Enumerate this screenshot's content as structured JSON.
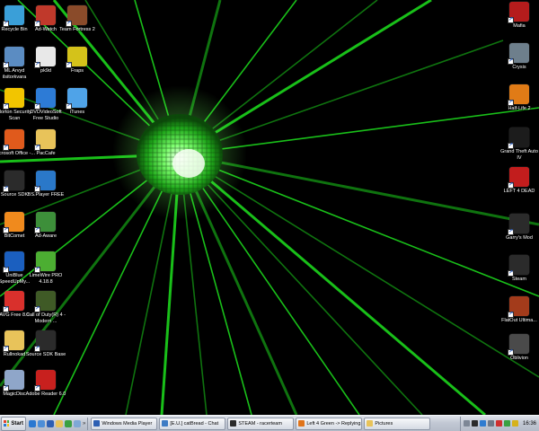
{
  "colors": {
    "laser": "#22ff22",
    "taskbar": "#c2c8d4",
    "desktop_bg": "#000000"
  },
  "desktop": {
    "left_icons": [
      {
        "label": "Recycle Bin",
        "icon": "recycle-bin-icon",
        "color": "#3a9fd8"
      },
      {
        "label": "Ad-Watch",
        "icon": "ad-watch-icon",
        "color": "#c0392b"
      },
      {
        "label": "Team Fortress 2",
        "icon": "team-fortress-icon",
        "color": "#8a4b2a"
      },
      {
        "label": "ML Arvyd ilsitorkvara",
        "icon": "shortcut-icon",
        "color": "#5b8cc2"
      },
      {
        "label": "pk9d",
        "icon": "file-icon",
        "color": "#e8e8e8"
      },
      {
        "label": "Fraps",
        "icon": "fraps-icon",
        "color": "#d4c21a"
      },
      {
        "label": "Norton Security Scan",
        "icon": "norton-icon",
        "color": "#f2c500"
      },
      {
        "label": "DVDVideoSoft Free Studio",
        "icon": "dvd-icon",
        "color": "#2d7bd6"
      },
      {
        "label": "iTunes",
        "icon": "itunes-icon",
        "color": "#4fa3e8"
      },
      {
        "label": "Microsoft Office -...",
        "icon": "office-icon",
        "color": "#e05a1c"
      },
      {
        "label": "PacCafe",
        "icon": "folder-icon",
        "color": "#e8c35a"
      },
      {
        "label": "Source SDK",
        "icon": "steam-icon",
        "color": "#2b2b2b"
      },
      {
        "label": "BS.Player FREE",
        "icon": "bsplayer-icon",
        "color": "#2a78c9"
      },
      {
        "label": "BitComet",
        "icon": "bitcomet-icon",
        "color": "#f08a1d"
      },
      {
        "label": "Ad-Aware",
        "icon": "ad-aware-icon",
        "color": "#3d8f3a"
      },
      {
        "label": "UniBlue SpeedUpMy...",
        "icon": "speedup-icon",
        "color": "#1b5fbf"
      },
      {
        "label": "LimeWire PRO 4.18.8",
        "icon": "limewire-icon",
        "color": "#4cae32"
      },
      {
        "label": "AVG Free 8.0",
        "icon": "avg-icon",
        "color": "#d9302c"
      },
      {
        "label": "Call of Duty(R) 4 - Modern ...",
        "icon": "call-of-duty-icon",
        "color": "#3f5a26"
      },
      {
        "label": "Rullnokad",
        "icon": "folder-icon",
        "color": "#e8c35a"
      },
      {
        "label": "Source SDK Base",
        "icon": "steam-icon",
        "color": "#2b2b2b"
      },
      {
        "label": "MagicDisc",
        "icon": "magicdisc-icon",
        "color": "#8fa6c9"
      },
      {
        "label": "Adobe Reader 6.0",
        "icon": "adobe-reader-icon",
        "color": "#c8201e"
      }
    ],
    "right_icons": [
      {
        "label": "Mafia",
        "icon": "mafia-icon",
        "color": "#b51c1c"
      },
      {
        "label": "Crysis",
        "icon": "crysis-icon",
        "color": "#6e7f8c"
      },
      {
        "label": "Half-Life 2",
        "icon": "half-life-icon",
        "color": "#e07b16"
      },
      {
        "label": "Grand Theft Auto IV",
        "icon": "gta-icon",
        "color": "#1c1c1c"
      },
      {
        "label": "LEFT 4 DEAD",
        "icon": "left4dead-icon",
        "color": "#c21d1d"
      },
      {
        "label": "Garry's Mod",
        "icon": "steam-icon",
        "color": "#2b2b2b"
      },
      {
        "label": "Steam",
        "icon": "steam-icon",
        "color": "#2b2b2b"
      },
      {
        "label": "FlatOut Ultima...",
        "icon": "flatout-icon",
        "color": "#a33b1b"
      },
      {
        "label": "Oblivion",
        "icon": "oblivion-icon",
        "color": "#4a4a4a"
      }
    ]
  },
  "taskbar": {
    "start_label": "Start",
    "quick_launch": [
      {
        "icon": "ie-icon",
        "color": "#2b78d1"
      },
      {
        "icon": "show-desktop-icon",
        "color": "#4d8ed8"
      },
      {
        "icon": "media-player-icon",
        "color": "#2d5fb3"
      },
      {
        "icon": "explorer-icon",
        "color": "#e8c35a"
      },
      {
        "icon": "messenger-icon",
        "color": "#3aa041"
      },
      {
        "icon": "mail-icon",
        "color": "#7fa8d6"
      }
    ],
    "quick_launch_more": "»",
    "tasks": [
      {
        "label": "Windows Media Player",
        "icon": "media-player-icon",
        "color": "#2d5fb3"
      },
      {
        "label": "[E.U.] catBread - Chat",
        "icon": "chat-icon",
        "color": "#3e7cc4"
      },
      {
        "label": "STEAM - racerteam",
        "icon": "steam-icon",
        "color": "#2b2b2b"
      },
      {
        "label": "Left 4 Green -> Replying...",
        "icon": "firefox-icon",
        "color": "#e0741a"
      },
      {
        "label": "Pictures",
        "icon": "folder-icon",
        "color": "#e8c35a"
      }
    ],
    "tray_icons": [
      {
        "icon": "tray-arrow-icon",
        "color": "#7d8796"
      },
      {
        "icon": "steam-tray-icon",
        "color": "#2b2b2b"
      },
      {
        "icon": "network-icon",
        "color": "#2e7bd0"
      },
      {
        "icon": "volume-icon",
        "color": "#6e7888"
      },
      {
        "icon": "antivirus-icon",
        "color": "#cf2f2f"
      },
      {
        "icon": "messenger-tray-icon",
        "color": "#3aa041"
      },
      {
        "icon": "security-icon",
        "color": "#d6b21a"
      }
    ],
    "clock": "16:36"
  }
}
